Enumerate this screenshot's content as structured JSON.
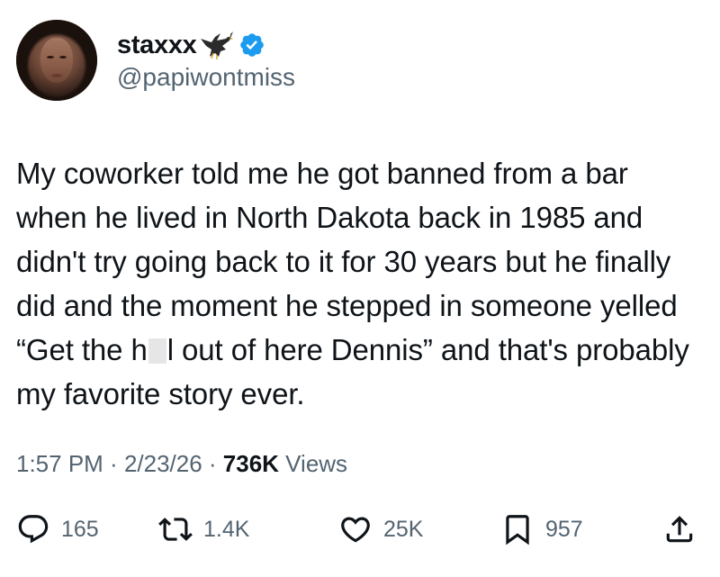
{
  "author": {
    "display_name": "staxxx",
    "handle": "@papiwontmiss"
  },
  "tweet": {
    "text_before": "My coworker told me he got banned from a bar when he lived in North Dakota back in 1985 and didn't try going back to it for 30 years but he finally did and the moment he stepped in someone yelled “Get the h",
    "text_after": "l out of here Dennis” and that's probably my favorite story ever."
  },
  "meta": {
    "time": "1:57 PM",
    "sep1": " · ",
    "date": "2/23/26",
    "sep2": " · ",
    "views_count": "736K",
    "views_label": " Views"
  },
  "actions": {
    "replies": "165",
    "reposts": "1.4K",
    "likes": "25K",
    "bookmarks": "957"
  },
  "colors": {
    "verified": "#1d9bf0",
    "text": "#0f1419",
    "secondary": "#536471"
  },
  "icons": [
    "eagle-icon",
    "verified-icon",
    "reply-icon",
    "repost-icon",
    "like-icon",
    "bookmark-icon",
    "share-icon"
  ]
}
